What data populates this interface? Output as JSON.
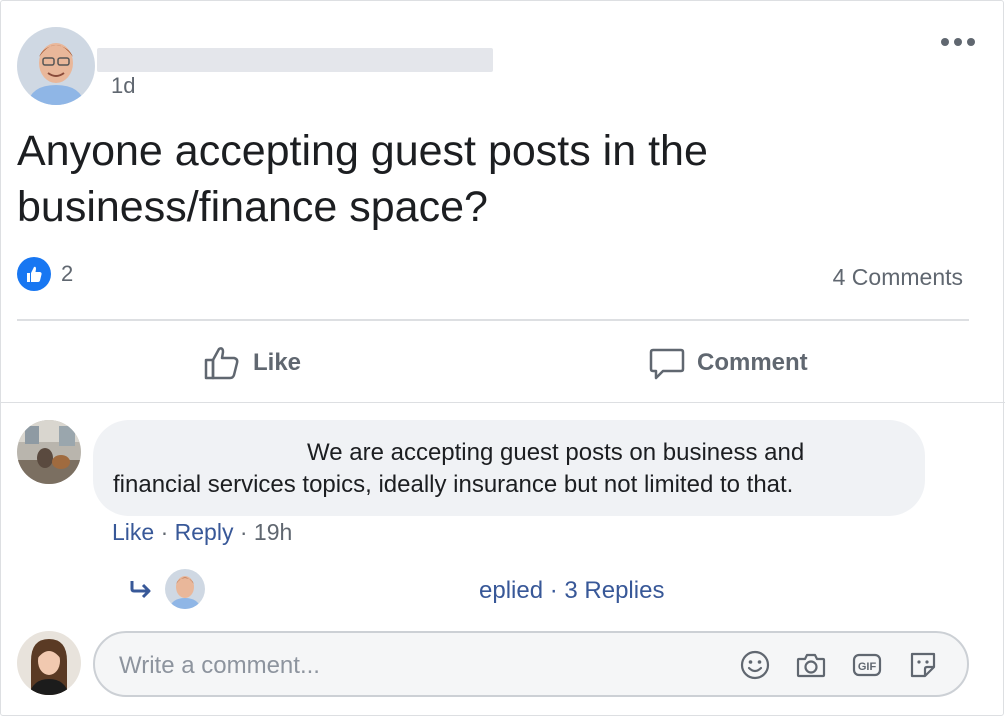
{
  "post": {
    "time": "1d",
    "text": "Anyone accepting guest posts in the business/finance space?",
    "reaction_count": "2",
    "comments_count": "4 Comments",
    "actions": {
      "like": "Like",
      "comment": "Comment"
    }
  },
  "comment": {
    "text_line1": "We are accepting guest posts on business and",
    "text_line2": "financial services topics, ideally insurance but not limited to that.",
    "like": "Like",
    "sep1": " · ",
    "reply": "Reply",
    "sep2": " · ",
    "time": "19h",
    "replies_summary": "eplied · 3 Replies"
  },
  "composer": {
    "placeholder": "Write a comment..."
  },
  "colors": {
    "accent": "#1877f2",
    "link": "#385898",
    "muted": "#606770"
  },
  "icons": [
    "more-icon",
    "like-icon",
    "thumbs-up-icon",
    "comment-icon",
    "reply-arrow-icon",
    "emoji-icon",
    "camera-icon",
    "gif-icon",
    "sticker-icon"
  ]
}
